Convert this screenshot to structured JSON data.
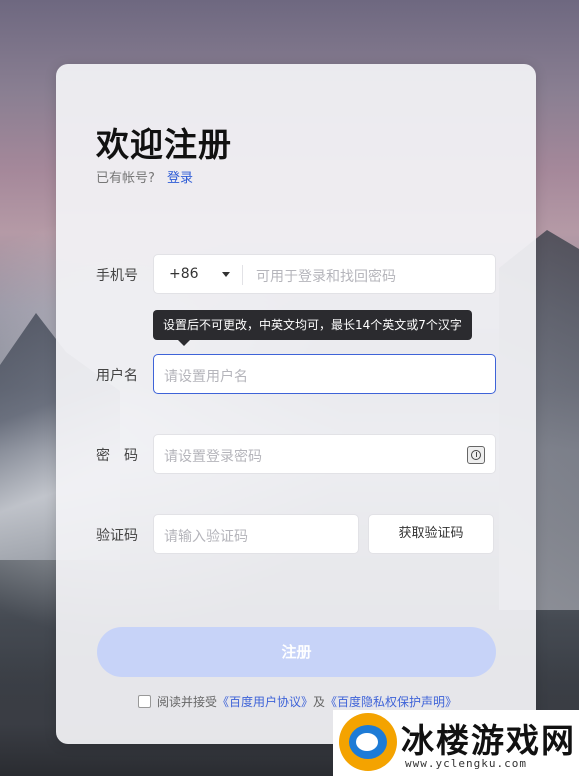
{
  "page": {
    "title": "欢迎注册",
    "subtitle": "已有帐号?",
    "login_link": "登录"
  },
  "form": {
    "phone": {
      "label": "手机号",
      "country_code": "+86",
      "placeholder": "可用于登录和找回密码"
    },
    "username": {
      "label": "用户名",
      "placeholder": "请设置用户名",
      "tooltip": "设置后不可更改，中英文均可，最长14个英文或7个汉字"
    },
    "password": {
      "label": "密　码",
      "placeholder": "请设置登录密码"
    },
    "code": {
      "label": "验证码",
      "placeholder": "请输入验证码",
      "button": "获取验证码"
    },
    "submit": "注册"
  },
  "agreement": {
    "text1": "阅读并接受",
    "link1": "《百度用户协议》",
    "text2": "及",
    "link2": "《百度隐私权保护声明》"
  },
  "watermark": {
    "text": "冰楼游戏网",
    "url": "www.yclengku.com"
  },
  "colors": {
    "accent": "#3e63d8",
    "submit_disabled": "#c7d3f8",
    "tooltip_bg": "#2b2b2f"
  }
}
